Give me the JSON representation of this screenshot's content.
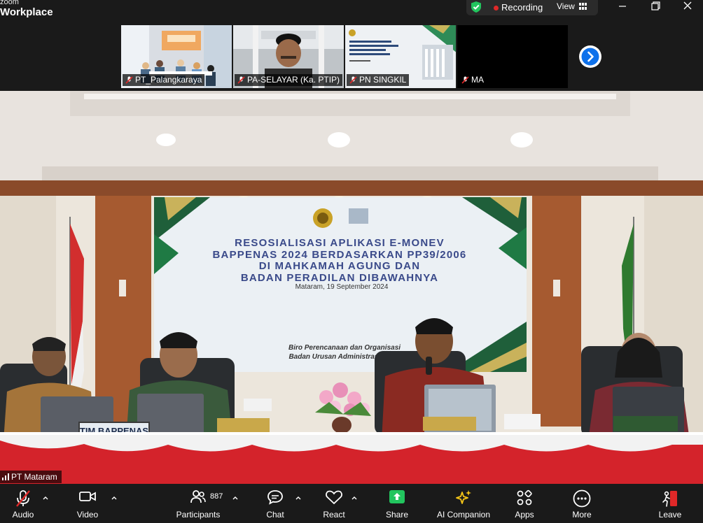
{
  "app": {
    "brand_top": "zoom",
    "brand_bottom": "Workplace"
  },
  "topbar": {
    "recording_label": "Recording",
    "view_label": "View"
  },
  "thumbnails": [
    {
      "name": "PT_Palangkaraya"
    },
    {
      "name": "PA-SELAYAR (Ka. PTIP)"
    },
    {
      "name": "PN SINGKIL"
    },
    {
      "name": "MA"
    }
  ],
  "stage": {
    "active_speaker": "PT Mataram",
    "banner": {
      "title_1": "RESOSIALISASI APLIKASI E-MONEV",
      "title_2": "BAPPENAS 2024 BERDASARKAN PP39/2006",
      "title_3": "DI MAHKAMAH AGUNG DAN",
      "title_4": "BADAN PERADILAN DIBAWAHNYA",
      "date": "Mataram, 19 September 2024",
      "org_1": "Biro Perencanaan dan Organisasi",
      "org_2": "Badan Urusan Administrasi Mahk"
    },
    "nameplate": "TIM BAPPENAS"
  },
  "toolbar": {
    "audio": "Audio",
    "video": "Video",
    "participants": "Participants",
    "participants_count": "887",
    "chat": "Chat",
    "react": "React",
    "share": "Share",
    "ai_companion": "AI Companion",
    "apps": "Apps",
    "more": "More",
    "leave": "Leave"
  },
  "colors": {
    "toolbar_bg": "#1a1a1a",
    "share_green": "#22c55e",
    "recording_red": "#e02828",
    "leave_red": "#e02828",
    "ai_gold": "#f5c518",
    "next_blue": "#0e71eb",
    "shield_green": "#22c55e"
  }
}
